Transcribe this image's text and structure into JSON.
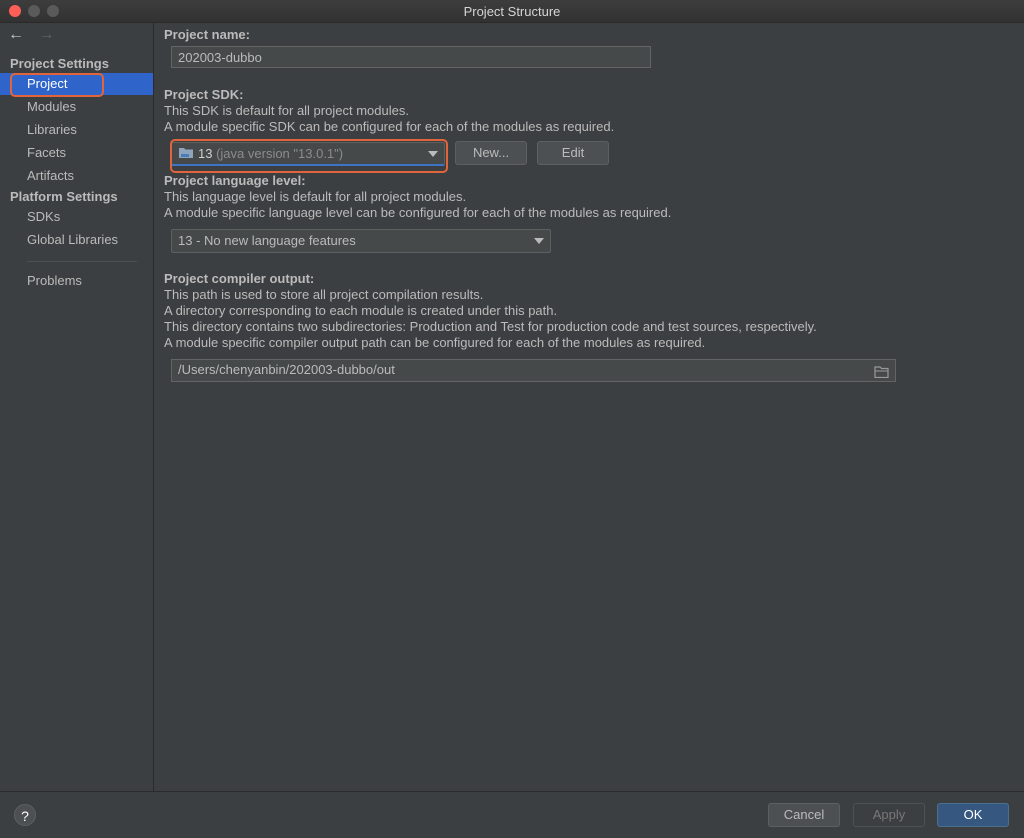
{
  "window": {
    "title": "Project Structure"
  },
  "nav": {
    "back": "←",
    "forward": "→"
  },
  "sidebar": {
    "project_settings_header": "Project Settings",
    "project_settings_items": [
      {
        "label": "Project",
        "selected": true
      },
      {
        "label": "Modules"
      },
      {
        "label": "Libraries"
      },
      {
        "label": "Facets"
      },
      {
        "label": "Artifacts"
      }
    ],
    "platform_settings_header": "Platform Settings",
    "platform_settings_items": [
      {
        "label": "SDKs"
      },
      {
        "label": "Global Libraries"
      }
    ],
    "problems": "Problems"
  },
  "main": {
    "project_name_label": "Project name:",
    "project_name_value": "202003-dubbo",
    "sdk_label": "Project SDK:",
    "sdk_desc1": "This SDK is default for all project modules.",
    "sdk_desc2": "A module specific SDK can be configured for each of the modules as required.",
    "sdk_selected_version": "13",
    "sdk_selected_detail": "(java version \"13.0.1\")",
    "new_button": "New...",
    "edit_button": "Edit",
    "language_label": "Project language level:",
    "language_desc1": "This language level is default for all project modules.",
    "language_desc2": "A module specific language level can be configured for each of the modules as required.",
    "language_value": "13 - No new language features",
    "output_label": "Project compiler output:",
    "output_desc1": "This path is used to store all project compilation results.",
    "output_desc2": "A directory corresponding to each module is created under this path.",
    "output_desc3": "This directory contains two subdirectories: Production and Test for production code and test sources, respectively.",
    "output_desc4": "A module specific compiler output path can be configured for each of the modules as required.",
    "output_path": "/Users/chenyanbin/202003-dubbo/out"
  },
  "footer": {
    "help": "?",
    "cancel": "Cancel",
    "apply": "Apply",
    "ok": "OK"
  },
  "colors": {
    "selection": "#2f65ca",
    "highlight_box": "#e0643c",
    "primary_button": "#365880"
  }
}
